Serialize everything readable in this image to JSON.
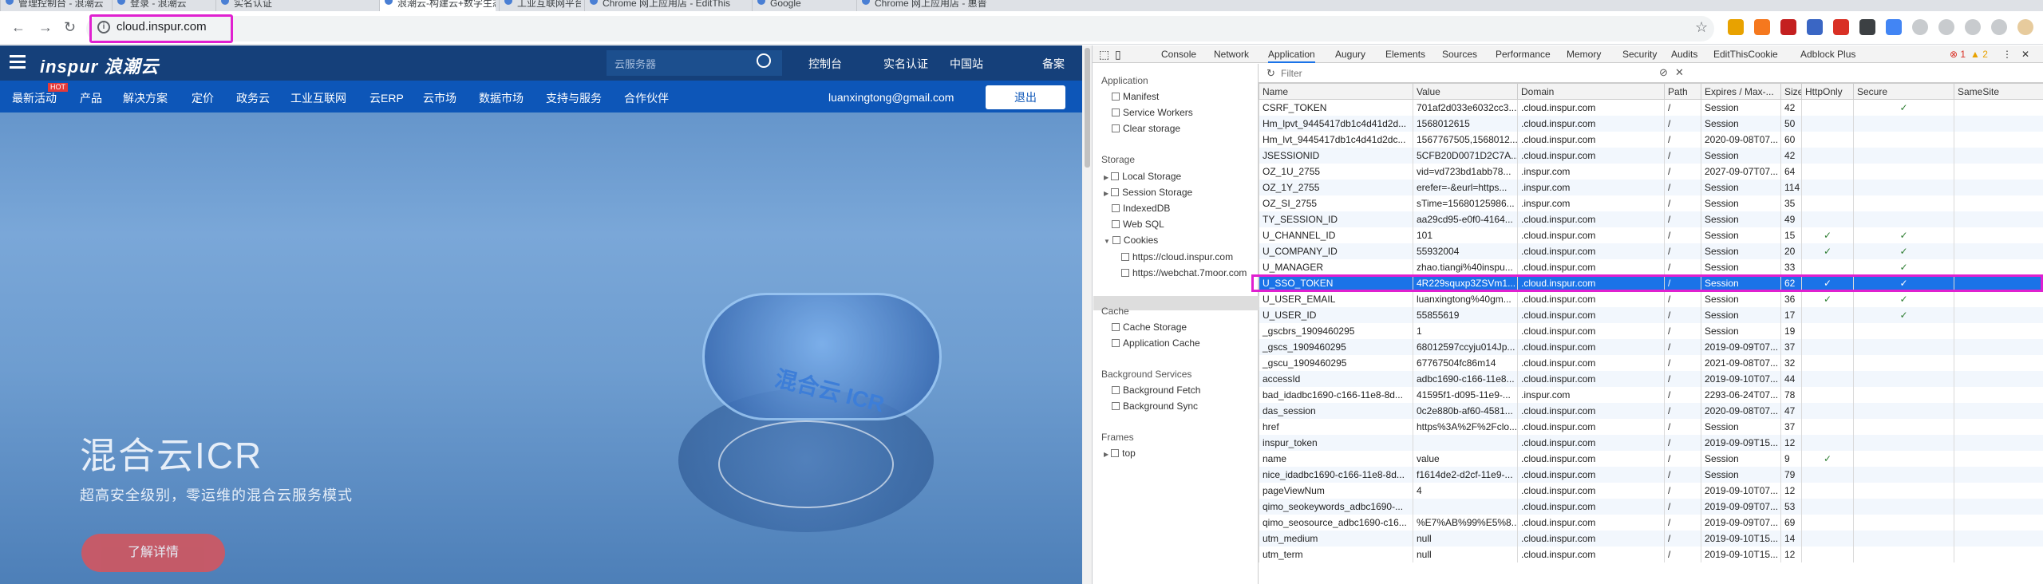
{
  "browser": {
    "tabs": [
      "管理控制台 - 浪潮云",
      "登录 - 浪潮云",
      "实名认证",
      "浪潮云-构建云+数字生态 让计算",
      "工业互联网平台",
      "Chrome 网上应用店 - EditThis",
      "Google",
      "Chrome 网上应用店 - 惠普"
    ],
    "url": "cloud.inspur.com"
  },
  "site": {
    "logo": "inspur 浪潮云",
    "search_placeholder": "云服务器",
    "top_links": [
      "控制台",
      "实名认证",
      "中国站",
      "备案"
    ],
    "nav": [
      "最新活动",
      "产品",
      "解决方案",
      "定价",
      "政务云",
      "工业互联网",
      "云ERP",
      "云市场",
      "数据市场",
      "支持与服务",
      "合作伙伴"
    ],
    "hot_badge": "HOT",
    "email": "luanxingtong@gmail.com",
    "logout": "退出",
    "hero_title": "混合云ICR",
    "hero_sub": "超高安全级别，零运维的混合云服务模式",
    "hero_button": "了解详情",
    "cloud_label": "混合云 ICR"
  },
  "devtools": {
    "tabs": [
      "Console",
      "Network",
      "Application",
      "Augury",
      "Elements",
      "Sources",
      "Performance",
      "Memory",
      "Security",
      "Audits",
      "EditThisCookie",
      "Adblock Plus"
    ],
    "active_tab": "Application",
    "errors": "1",
    "warnings": "2",
    "filter_placeholder": "Filter",
    "sidebar": {
      "application_title": "Application",
      "application": [
        "Manifest",
        "Service Workers",
        "Clear storage"
      ],
      "storage_title": "Storage",
      "storage": [
        "Local Storage",
        "Session Storage",
        "IndexedDB",
        "Web SQL",
        "Cookies"
      ],
      "cookies": [
        "https://cloud.inspur.com",
        "https://webchat.7moor.com"
      ],
      "cache_title": "Cache",
      "cache": [
        "Cache Storage",
        "Application Cache"
      ],
      "bg_title": "Background Services",
      "bg": [
        "Background Fetch",
        "Background Sync"
      ],
      "frames_title": "Frames",
      "frames": [
        "top"
      ]
    },
    "columns": [
      "Name",
      "Value",
      "Domain",
      "Path",
      "Expires / Max-...",
      "Size",
      "HttpOnly",
      "Secure",
      "SameSite"
    ],
    "rows": [
      [
        "CSRF_TOKEN",
        "701af2d033e6032cc3...",
        ".cloud.inspur.com",
        "/",
        "Session",
        "42",
        "",
        "✓",
        ""
      ],
      [
        "Hm_lpvt_9445417db1c4d41d2d...",
        "1568012615",
        ".cloud.inspur.com",
        "/",
        "Session",
        "50",
        "",
        "",
        ""
      ],
      [
        "Hm_lvt_9445417db1c4d41d2dc...",
        "1567767505,1568012...",
        ".cloud.inspur.com",
        "/",
        "2020-09-08T07...",
        "60",
        "",
        "",
        ""
      ],
      [
        "JSESSIONID",
        "5CFB20D0071D2C7A...",
        ".cloud.inspur.com",
        "/",
        "Session",
        "42",
        "",
        "",
        ""
      ],
      [
        "OZ_1U_2755",
        "vid=vd723bd1abb78...",
        ".inspur.com",
        "/",
        "2027-09-07T07...",
        "64",
        "",
        "",
        ""
      ],
      [
        "OZ_1Y_2755",
        "erefer=-&eurl=https...",
        ".inspur.com",
        "/",
        "Session",
        "114",
        "",
        "",
        ""
      ],
      [
        "OZ_SI_2755",
        "sTime=15680125986...",
        ".inspur.com",
        "/",
        "Session",
        "35",
        "",
        "",
        ""
      ],
      [
        "TY_SESSION_ID",
        "aa29cd95-e0f0-4164...",
        ".cloud.inspur.com",
        "/",
        "Session",
        "49",
        "",
        "",
        ""
      ],
      [
        "U_CHANNEL_ID",
        "101",
        ".cloud.inspur.com",
        "/",
        "Session",
        "15",
        "✓",
        "✓",
        ""
      ],
      [
        "U_COMPANY_ID",
        "55932004",
        ".cloud.inspur.com",
        "/",
        "Session",
        "20",
        "✓",
        "✓",
        ""
      ],
      [
        "U_MANAGER",
        "zhao.tiangi%40inspu...",
        ".cloud.inspur.com",
        "/",
        "Session",
        "33",
        "",
        "✓",
        ""
      ],
      [
        "U_SSO_TOKEN",
        "4R229squxp3ZSVm1...",
        ".cloud.inspur.com",
        "/",
        "Session",
        "62",
        "✓",
        "✓",
        ""
      ],
      [
        "U_USER_EMAIL",
        "luanxingtong%40gm...",
        ".cloud.inspur.com",
        "/",
        "Session",
        "36",
        "✓",
        "✓",
        ""
      ],
      [
        "U_USER_ID",
        "55855619",
        ".cloud.inspur.com",
        "/",
        "Session",
        "17",
        "",
        "✓",
        ""
      ],
      [
        "_gscbrs_1909460295",
        "1",
        ".cloud.inspur.com",
        "/",
        "Session",
        "19",
        "",
        "",
        ""
      ],
      [
        "_gscs_1909460295",
        "68012597ccyju014Jp...",
        ".cloud.inspur.com",
        "/",
        "2019-09-09T07...",
        "37",
        "",
        "",
        ""
      ],
      [
        "_gscu_1909460295",
        "67767504fc86m14",
        ".cloud.inspur.com",
        "/",
        "2021-09-08T07...",
        "32",
        "",
        "",
        ""
      ],
      [
        "accessId",
        "adbc1690-c166-11e8...",
        ".cloud.inspur.com",
        "/",
        "2019-09-10T07...",
        "44",
        "",
        "",
        ""
      ],
      [
        "bad_idadbc1690-c166-11e8-8d...",
        "41595f1-d095-11e9-...",
        ".inspur.com",
        "/",
        "2293-06-24T07...",
        "78",
        "",
        "",
        ""
      ],
      [
        "das_session",
        "0c2e880b-af60-4581...",
        ".cloud.inspur.com",
        "/",
        "2020-09-08T07...",
        "47",
        "",
        "",
        ""
      ],
      [
        "href",
        "https%3A%2F%2Fclo...",
        ".cloud.inspur.com",
        "/",
        "Session",
        "37",
        "",
        "",
        ""
      ],
      [
        "inspur_token",
        "",
        ".cloud.inspur.com",
        "/",
        "2019-09-09T15...",
        "12",
        "",
        "",
        ""
      ],
      [
        "name",
        "value",
        ".cloud.inspur.com",
        "/",
        "Session",
        "9",
        "✓",
        "",
        ""
      ],
      [
        "nice_idadbc1690-c166-11e8-8d...",
        "f1614de2-d2cf-11e9-...",
        ".cloud.inspur.com",
        "/",
        "Session",
        "79",
        "",
        "",
        ""
      ],
      [
        "pageViewNum",
        "4",
        ".cloud.inspur.com",
        "/",
        "2019-09-10T07...",
        "12",
        "",
        "",
        ""
      ],
      [
        "qimo_seokeywords_adbc1690-...",
        "",
        ".cloud.inspur.com",
        "/",
        "2019-09-09T07...",
        "53",
        "",
        "",
        ""
      ],
      [
        "qimo_seosource_adbc1690-c16...",
        "%E7%AB%99%E5%8...",
        ".cloud.inspur.com",
        "/",
        "2019-09-09T07...",
        "69",
        "",
        "",
        ""
      ],
      [
        "utm_medium",
        "null",
        ".cloud.inspur.com",
        "/",
        "2019-09-10T15...",
        "14",
        "",
        "",
        ""
      ],
      [
        "utm_term",
        "null",
        ".cloud.inspur.com",
        "/",
        "2019-09-10T15...",
        "12",
        "",
        "",
        ""
      ]
    ],
    "selected_row": 11
  }
}
